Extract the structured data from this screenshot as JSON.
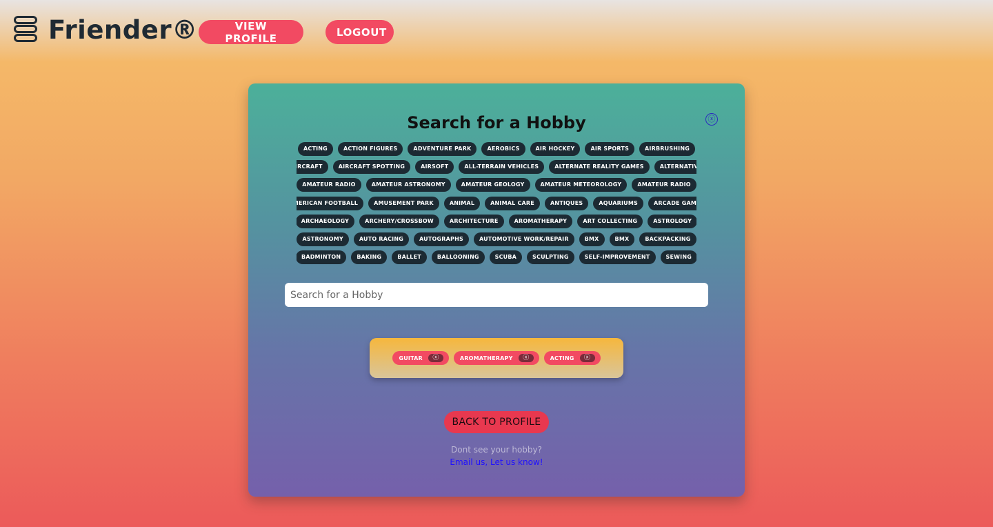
{
  "header": {
    "brand": "Friender®",
    "nav": {
      "view_profile": "VIEW PROFILE",
      "logout": "LOGOUT"
    },
    "menu_icon": "hamburger-stack-icon"
  },
  "modal": {
    "title": "Search for a Hobby",
    "close_symbol": "ⓧ",
    "hobby_rows": [
      [
        "ACTING",
        "ACTION FIGURES",
        "ADVENTURE PARK",
        "AEROBICS",
        "AIR HOCKEY",
        "AIR SPORTS",
        "AIRBRUSHING"
      ],
      [
        "AIRCRAFT",
        "AIRCRAFT SPOTTING",
        "AIRSOFT",
        "ALL-TERRAIN VEHICLES",
        "ALTERNATE REALITY GAMES",
        "ALTERNATIVE"
      ],
      [
        "AMATEUR RADIO",
        "AMATEUR ASTRONOMY",
        "AMATEUR GEOLOGY",
        "AMATEUR METEOROLOGY",
        "AMATEUR RADIO"
      ],
      [
        "AMERICAN FOOTBALL",
        "AMUSEMENT PARK",
        "ANIMAL",
        "ANIMAL CARE",
        "ANTIQUES",
        "AQUARIUMS",
        "ARCADE GAMES"
      ],
      [
        "ARCHAEOLOGY",
        "ARCHERY/CROSSBOW",
        "ARCHITECTURE",
        "AROMATHERAPY",
        "ART COLLECTING",
        "ASTROLOGY"
      ],
      [
        "ASTRONOMY",
        "AUTO RACING",
        "AUTOGRAPHS",
        "AUTOMOTIVE WORK/REPAIR",
        "BMX",
        "BMX",
        "BACKPACKING"
      ],
      [
        "BADMINTON",
        "BAKING",
        "BALLET",
        "BALLOONING",
        "SCUBA",
        "SCULPTING",
        "SELF-IMPROVEMENT",
        "SEWING"
      ]
    ],
    "search": {
      "placeholder": "Search for a Hobby",
      "value": ""
    },
    "selected": [
      {
        "label": "GUITAR",
        "remove": "ⓧ"
      },
      {
        "label": "AROMATHERAPY",
        "remove": "ⓧ"
      },
      {
        "label": "ACTING",
        "remove": "ⓧ"
      }
    ],
    "back_button": "BACK TO PROFILE",
    "hint": "Dont see your hobby?",
    "email_link": "Email us, Let us know!"
  },
  "colors": {
    "accent": "#f24a62",
    "chip_dark": "#1c2a33",
    "modal_top": "#4cb09a",
    "modal_bottom": "#7560ab",
    "link": "#1f10ff"
  }
}
